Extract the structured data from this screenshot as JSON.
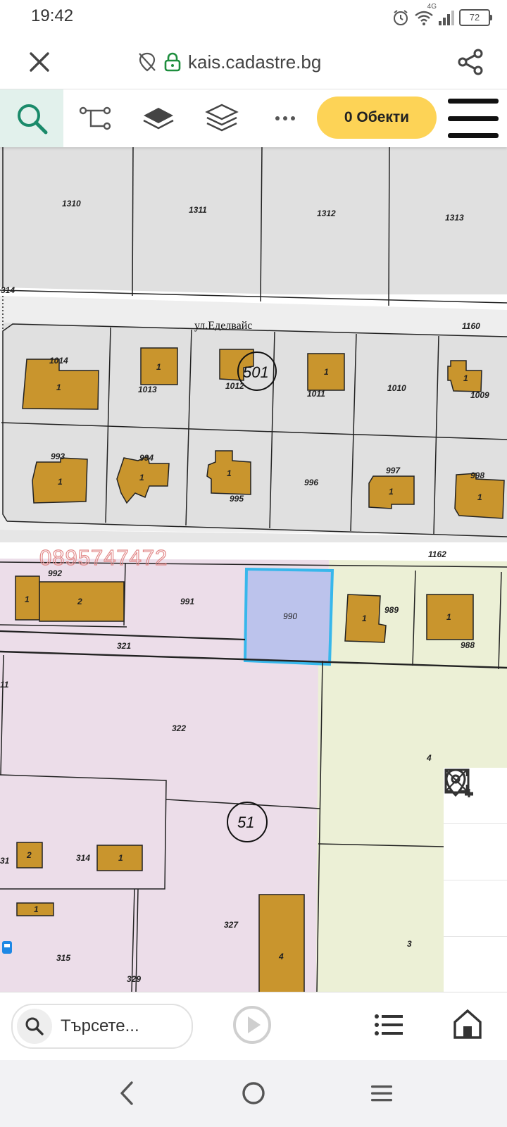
{
  "status_bar": {
    "time": "19:42",
    "network": "4G",
    "battery": "72",
    "icons": [
      "alarm-icon",
      "wifi-icon",
      "signal-icon",
      "battery-icon"
    ]
  },
  "browser": {
    "url": "kais.cadastre.bg",
    "close_icon": "close-icon",
    "tracking_icon": "tracking-off-icon",
    "lock_icon": "lock-icon",
    "share_icon": "share-icon"
  },
  "toolbar": {
    "objects_label": "0 Обекти",
    "icons": [
      "search-icon",
      "route-icon",
      "layer-icon",
      "layers-icon",
      "more-icon",
      "menu-icon"
    ]
  },
  "map": {
    "watermark": "0895747472",
    "street_label": "ул.Еделвайс",
    "parcel_labels": {
      "p1310": "1310",
      "p1311": "1311",
      "p1312": "1312",
      "p1313": "1313",
      "p314t": "314",
      "p1160": "1160",
      "p1014": "1014",
      "p1013": "1013",
      "p1012": "1012",
      "p1011": "1011",
      "p1010": "1010",
      "p1009": "1009",
      "p993": "993",
      "p994": "994",
      "p995": "995",
      "p996": "996",
      "p997": "997",
      "p998": "998",
      "p1162": "1162",
      "p992": "992",
      "p991": "991",
      "p990": "990",
      "p989": "989",
      "p988": "988",
      "p321": "321",
      "p322": "322",
      "p11": "11",
      "p4": "4",
      "p314": "314",
      "p31": "31",
      "p327": "327",
      "p315": "315",
      "p329": "329",
      "p3": "3"
    },
    "block_labels": {
      "b501": "501",
      "b51": "51"
    },
    "building_labels": {
      "one": "1",
      "two": "2",
      "four": "4"
    },
    "colors": {
      "grey_zone": "#e0e0e0",
      "street": "#eeeeee",
      "pink_zone": "#ecdde9",
      "yellow_zone": "#ecf0d6",
      "selected_parcel": "#bcc3ec",
      "selected_border": "#37b7eb",
      "building": "#c9952d",
      "watermark": "#e28a8a"
    }
  },
  "map_controls": [
    "location-pin-icon",
    "add-area-icon",
    "remove-area-icon",
    "fullscreen-icon"
  ],
  "bottom_bar": {
    "search_placeholder": "Търсете...",
    "icons": [
      "search-icon",
      "play-icon",
      "list-icon",
      "home-icon"
    ]
  },
  "system_nav": [
    "back-icon",
    "home-circle-icon",
    "recent-apps-icon"
  ]
}
